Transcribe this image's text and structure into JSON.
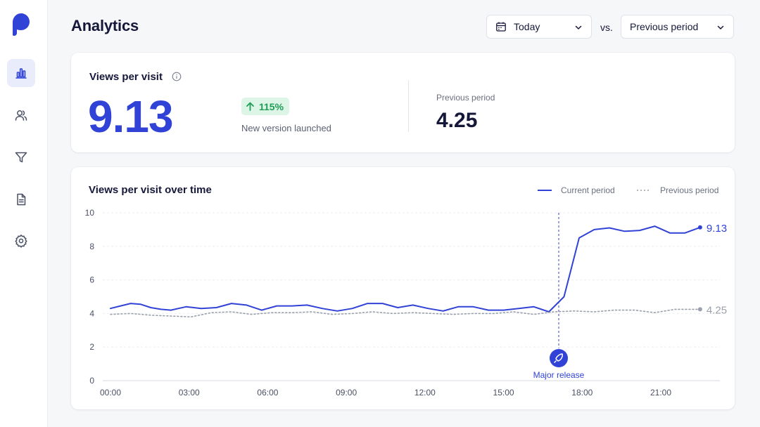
{
  "header": {
    "title": "Analytics",
    "date_range": "Today",
    "vs_label": "vs.",
    "compare_range": "Previous period"
  },
  "sidebar": {
    "items": [
      {
        "icon": "bar-chart-icon",
        "active": true
      },
      {
        "icon": "users-icon",
        "active": false
      },
      {
        "icon": "filter-icon",
        "active": false
      },
      {
        "icon": "document-icon",
        "active": false
      },
      {
        "icon": "settings-icon",
        "active": false
      }
    ]
  },
  "kpi": {
    "label": "Views per visit",
    "value": "9.13",
    "change": "115%",
    "note": "New version launched",
    "previous_label": "Previous period",
    "previous_value": "4.25"
  },
  "chart": {
    "title": "Views per visit over time",
    "legend_current": "Current period",
    "legend_previous": "Previous period",
    "annotation": "Major release",
    "end_label_current": "9.13",
    "end_label_previous": "4.25"
  },
  "colors": {
    "accent": "#3143d6",
    "previous": "#9aa0ab",
    "positive": "#1e9d56",
    "positive_bg": "#ddf5e6"
  },
  "chart_data": {
    "type": "line",
    "title": "Views per visit over time",
    "xlabel": "",
    "ylabel": "",
    "xticks": [
      "00:00",
      "03:00",
      "06:00",
      "09:00",
      "12:00",
      "15:00",
      "18:00",
      "21:00"
    ],
    "yticks": [
      0,
      2,
      4,
      6,
      8,
      10
    ],
    "ylim": [
      0,
      10
    ],
    "xlim_hours": [
      -0.4,
      23.4
    ],
    "annotation": {
      "x_hour": 17.0,
      "label": "Major release"
    },
    "grid": true,
    "legend_position": "top-right",
    "series": [
      {
        "name": "Current period",
        "style": "solid",
        "color": "#3143d6",
        "points": [
          [
            0.0,
            4.3
          ],
          [
            0.1,
            4.45
          ],
          [
            0.2,
            4.6
          ],
          [
            0.3,
            4.55
          ],
          [
            0.4,
            4.35
          ],
          [
            0.5,
            4.25
          ],
          [
            0.6,
            4.2
          ],
          [
            0.75,
            4.4
          ],
          [
            0.9,
            4.3
          ],
          [
            1.05,
            4.35
          ],
          [
            1.2,
            4.6
          ],
          [
            1.35,
            4.5
          ],
          [
            1.5,
            4.2
          ],
          [
            1.65,
            4.45
          ],
          [
            1.8,
            4.45
          ],
          [
            1.95,
            4.5
          ],
          [
            2.1,
            4.3
          ],
          [
            2.25,
            4.15
          ],
          [
            2.4,
            4.3
          ],
          [
            2.55,
            4.6
          ],
          [
            2.7,
            4.6
          ],
          [
            2.85,
            4.35
          ],
          [
            3.0,
            4.5
          ],
          [
            3.15,
            4.3
          ],
          [
            3.3,
            4.15
          ],
          [
            3.45,
            4.4
          ],
          [
            3.6,
            4.4
          ],
          [
            3.75,
            4.2
          ],
          [
            3.9,
            4.2
          ],
          [
            4.05,
            4.3
          ],
          [
            4.2,
            4.4
          ],
          [
            4.35,
            4.1
          ],
          [
            4.5,
            5.0
          ],
          [
            4.65,
            8.5
          ],
          [
            4.8,
            9.0
          ],
          [
            4.95,
            9.1
          ],
          [
            5.1,
            8.9
          ],
          [
            5.25,
            8.95
          ],
          [
            5.4,
            9.2
          ],
          [
            5.55,
            8.8
          ],
          [
            5.7,
            8.8
          ],
          [
            5.85,
            9.13
          ]
        ]
      },
      {
        "name": "Previous period",
        "style": "dotted",
        "color": "#9aa0ab",
        "points": [
          [
            0.0,
            3.95
          ],
          [
            0.2,
            4.0
          ],
          [
            0.4,
            3.9
          ],
          [
            0.6,
            3.85
          ],
          [
            0.8,
            3.8
          ],
          [
            1.0,
            4.05
          ],
          [
            1.2,
            4.1
          ],
          [
            1.4,
            3.95
          ],
          [
            1.6,
            4.05
          ],
          [
            1.8,
            4.05
          ],
          [
            2.0,
            4.1
          ],
          [
            2.2,
            3.95
          ],
          [
            2.4,
            4.0
          ],
          [
            2.6,
            4.1
          ],
          [
            2.8,
            4.0
          ],
          [
            3.0,
            4.05
          ],
          [
            3.2,
            4.0
          ],
          [
            3.4,
            3.95
          ],
          [
            3.6,
            4.0
          ],
          [
            3.8,
            4.0
          ],
          [
            4.0,
            4.1
          ],
          [
            4.2,
            3.95
          ],
          [
            4.4,
            4.1
          ],
          [
            4.6,
            4.15
          ],
          [
            4.8,
            4.1
          ],
          [
            5.0,
            4.2
          ],
          [
            5.2,
            4.2
          ],
          [
            5.4,
            4.05
          ],
          [
            5.6,
            4.25
          ],
          [
            5.85,
            4.25
          ]
        ]
      }
    ]
  }
}
